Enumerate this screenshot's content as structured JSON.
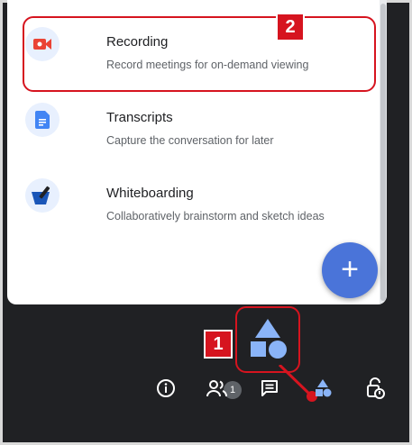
{
  "features": [
    {
      "title": "Recording",
      "description": "Record meetings for on-demand viewing",
      "icon": "video-camera-icon"
    },
    {
      "title": "Transcripts",
      "description": "Capture the conversation for later",
      "icon": "document-icon"
    },
    {
      "title": "Whiteboarding",
      "description": "Collaboratively brainstorm and sketch ideas",
      "icon": "whiteboard-icon"
    }
  ],
  "fab": {
    "label": "+"
  },
  "callouts": {
    "first": "1",
    "second": "2"
  },
  "toolbar": {
    "participants_badge": "1"
  },
  "colors": {
    "accent": "#4a74d9",
    "callout": "#d6141f",
    "background": "#202124"
  }
}
